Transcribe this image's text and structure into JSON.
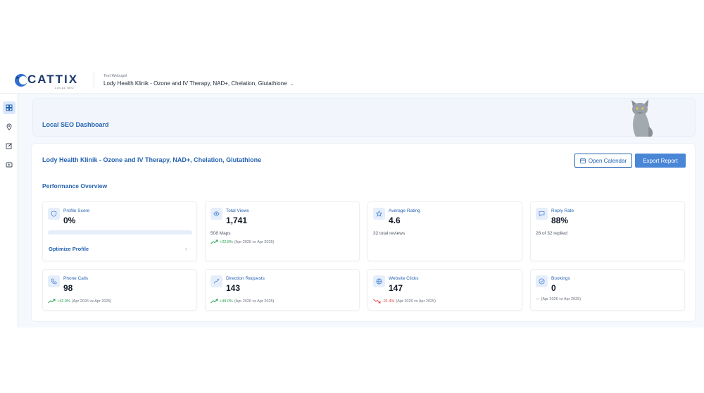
{
  "brand": {
    "name": "CATTIX",
    "tagline": "LOCAL SEO"
  },
  "account": {
    "label": "Test Webugol",
    "business": "Lody Health Klinik - Ozone and IV Therapy, NAD+, Chelation, Glutathione",
    "chevron": "⌄"
  },
  "sidebar": {
    "items": [
      {
        "icon": "dashboard-icon",
        "active": true
      },
      {
        "icon": "location-pin-icon",
        "active": false
      },
      {
        "icon": "edit-post-icon",
        "active": false
      },
      {
        "icon": "media-icon",
        "active": false
      }
    ]
  },
  "banner": {
    "title": "Local SEO Dashboard"
  },
  "panel": {
    "business_title": "Lody Health Klinik - Ozone and IV Therapy, NAD+, Chelation, Glutathione",
    "open_calendar": "Open Calendar",
    "export_report": "Export Report",
    "section_title": "Performance Overview"
  },
  "metrics": {
    "profile_score": {
      "label": "Profile Score",
      "value": "0%",
      "progress": 0,
      "link": "Optimize Profile",
      "chevron": "›"
    },
    "total_views": {
      "label": "Total Views",
      "value": "1,741",
      "sub": "508 Maps",
      "change": "+22.8%",
      "period": "(Apr 2026 vs Apr 2025)"
    },
    "average_rating": {
      "label": "Average Rating",
      "value": "4.6",
      "sub": "32 total reviews"
    },
    "reply_rate": {
      "label": "Reply Rate",
      "value": "88%",
      "sub": "28 of 32 replied"
    },
    "phone_calls": {
      "label": "Phone Calls",
      "value": "98",
      "change": "+42.0%",
      "period": "(Apr 2026 vs Apr 2025)"
    },
    "direction_requests": {
      "label": "Direction Requests",
      "value": "143",
      "change": "+49.0%",
      "period": "(Apr 2026 vs Apr 2025)"
    },
    "website_clicks": {
      "label": "Website Clicks",
      "value": "147",
      "change": "-21.4%",
      "period": "(Apr 2026 vs Apr 2025)"
    },
    "bookings": {
      "label": "Bookings",
      "value": "0",
      "change": "—",
      "period": "(Apr 2026 vs Apr 2025)"
    }
  },
  "colors": {
    "accent": "#2563b0",
    "button": "#4a86d6",
    "up": "#22a04b",
    "down": "#e0413c"
  }
}
